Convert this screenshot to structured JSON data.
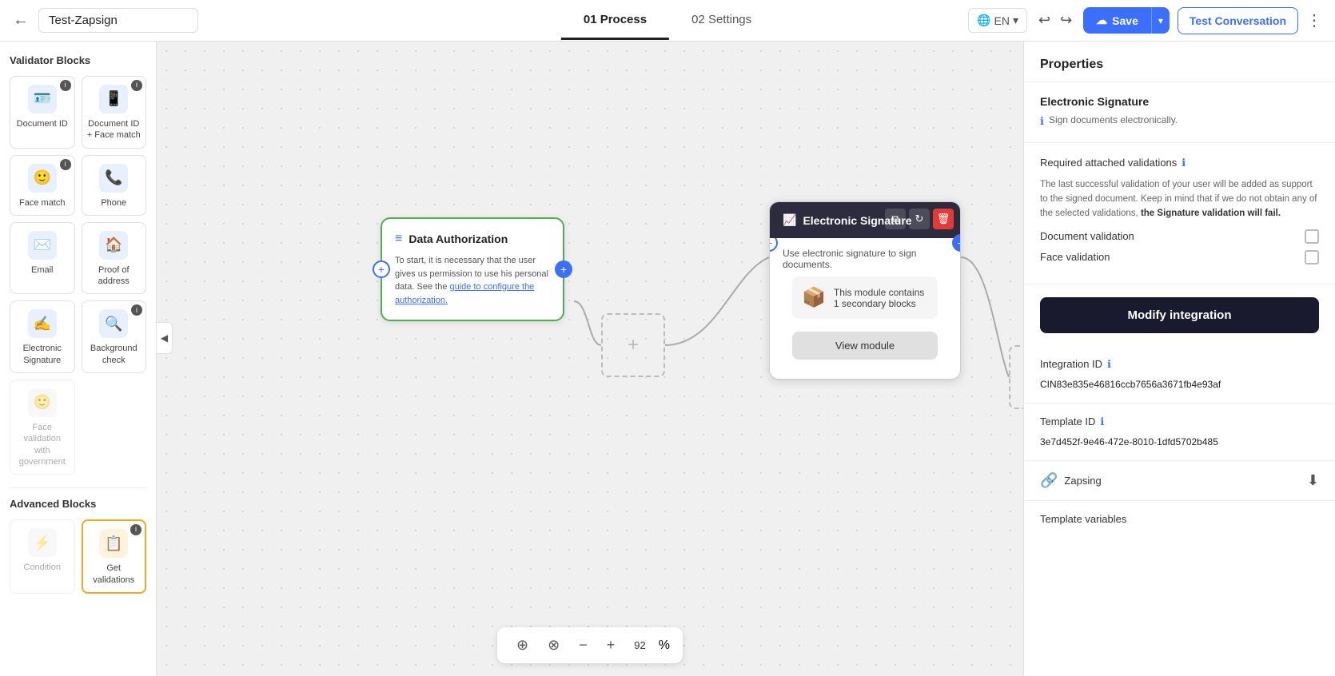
{
  "topNav": {
    "back_label": "←",
    "title": "Test-Zapsign",
    "tab_process": "01 Process",
    "tab_settings": "02 Settings",
    "lang": "EN",
    "save_label": "Save",
    "test_label": "Test Conversation",
    "zoom": 92
  },
  "sidebar": {
    "validator_section": "Validator Blocks",
    "advanced_section": "Advanced Blocks",
    "blocks": [
      {
        "id": "doc-id",
        "label": "Document ID",
        "icon": "🪪",
        "type": "blue",
        "badge": true,
        "disabled": false
      },
      {
        "id": "doc-id-face",
        "label": "Document ID + Face match",
        "icon": "📱",
        "type": "blue",
        "badge": true,
        "disabled": false
      },
      {
        "id": "face-match",
        "label": "Face match",
        "icon": "🙂",
        "type": "blue",
        "badge": true,
        "disabled": false
      },
      {
        "id": "phone",
        "label": "Phone",
        "icon": "📞",
        "type": "blue",
        "badge": false,
        "disabled": false
      },
      {
        "id": "email",
        "label": "Email",
        "icon": "✉️",
        "type": "blue",
        "badge": false,
        "disabled": false
      },
      {
        "id": "proof-address",
        "label": "Proof of address",
        "icon": "🏠",
        "type": "blue",
        "badge": false,
        "disabled": false
      },
      {
        "id": "esign",
        "label": "Electronic Signature",
        "icon": "✍️",
        "type": "blue",
        "badge": false,
        "disabled": false
      },
      {
        "id": "bg-check",
        "label": "Background check",
        "icon": "🔍",
        "type": "blue",
        "badge": true,
        "disabled": false
      },
      {
        "id": "face-gov",
        "label": "Face validation with government",
        "icon": "🙂",
        "type": "gray",
        "badge": false,
        "disabled": true
      }
    ],
    "advanced_blocks": [
      {
        "id": "condition",
        "label": "Condition",
        "icon": "⚡",
        "type": "gray",
        "badge": false,
        "disabled": true
      },
      {
        "id": "get-validations",
        "label": "Get validations",
        "icon": "📋",
        "type": "orange",
        "badge": true,
        "disabled": false
      }
    ]
  },
  "canvas": {
    "dataAuth": {
      "title": "Data Authorization",
      "icon": "≡",
      "desc": "To start, it is necessary that the user gives us permission to use his personal data. See the ",
      "link_text": "guide to configure the authorization.",
      "link_url": "#"
    },
    "esign": {
      "title": "Electronic Signature",
      "icon": "📈",
      "desc": "Use electronic signature to sign documents.",
      "secondary_text": "This module contains 1 secondary blocks",
      "view_module_label": "View module",
      "actions": [
        "copy",
        "refresh",
        "delete"
      ]
    },
    "zoom_label": "92%"
  },
  "properties": {
    "panel_title": "Properties",
    "section_title": "Electronic Signature",
    "desc": "Sign documents electronically.",
    "required_validations_label": "Required attached validations",
    "required_note": "The last successful validation of your user will be added as support to the signed document. Keep in mind that if we do not obtain any of the selected validations, ",
    "required_note_bold": "the Signature validation will fail.",
    "doc_validation_label": "Document validation",
    "face_validation_label": "Face validation",
    "modify_btn_label": "Modify integration",
    "integration_id_label": "Integration ID",
    "integration_id_value": "CIN83e835e46816ccb7656a3671fb4e93af",
    "template_id_label": "Template ID",
    "template_id_value": "3e7d452f-9e46-472e-8010-1dfd5702b485",
    "zapsing_label": "Zapsing",
    "template_vars_label": "Template variables"
  },
  "icons": {
    "back": "←",
    "chevron_down": "▾",
    "globe": "🌐",
    "undo": "↩",
    "redo": "↪",
    "cloud": "☁",
    "collapse": "◀",
    "focus": "⊕",
    "share": "⊗",
    "zoom_in": "⊕",
    "zoom_out": "⊖",
    "copy": "⧉",
    "refresh": "↻",
    "delete": "🗑",
    "info": "ℹ",
    "download": "⬇",
    "zapsing_icon": "🔗"
  }
}
